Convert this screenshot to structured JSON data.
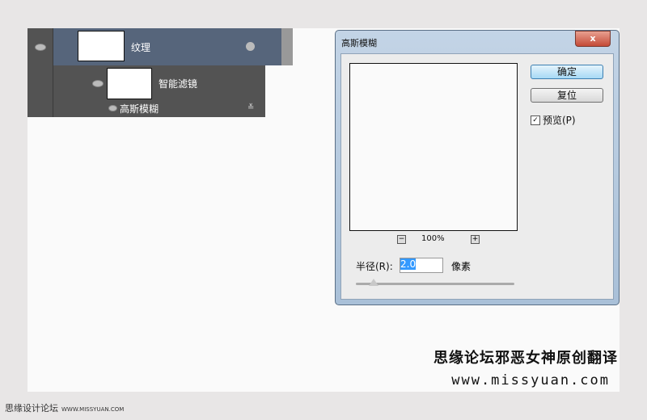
{
  "layers": {
    "layer_name": "纹理",
    "smart_filters": "智能滤镜",
    "filter": "高斯模糊"
  },
  "dialog": {
    "title": "高斯模糊",
    "close": "x",
    "ok": "确定",
    "reset": "复位",
    "preview_label": "预览(P)",
    "preview_checked": true,
    "zoom_out": "−",
    "zoom": "100%",
    "zoom_in": "+",
    "radius_label": "半径(R):",
    "radius_value": "2.0",
    "unit": "像素",
    "slider_fraction": 0.1
  },
  "watermark": {
    "line1": "思缘论坛邪恶女神原创翻译",
    "line2": "www.missyuan.com"
  },
  "footer": {
    "site": "思缘设计论坛",
    "url": "WWW.MISSYUAN.COM"
  }
}
